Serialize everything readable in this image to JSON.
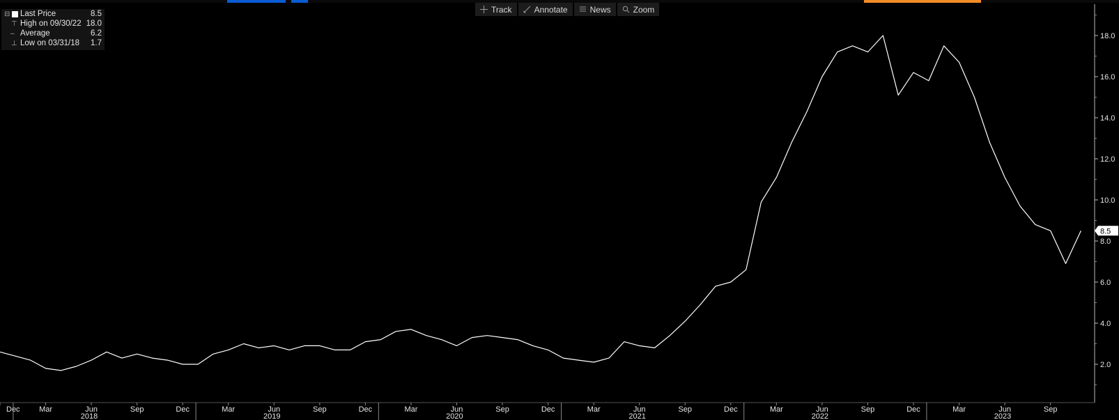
{
  "toolbar": {
    "track_label": "Track",
    "annotate_label": "Annotate",
    "news_label": "News",
    "zoom_label": "Zoom"
  },
  "legend": {
    "rows": [
      {
        "label": "Last Price",
        "value": "8.5"
      },
      {
        "label": "High on 09/30/22",
        "value": "18.0"
      },
      {
        "label": "Average",
        "value": "6.2"
      },
      {
        "label": "Low on 03/31/18",
        "value": "1.7"
      }
    ]
  },
  "colors": {
    "background": "#000000",
    "line": "#ffffff",
    "tab_blue": "#0b5bd3",
    "tab_orange": "#f28c28"
  },
  "last_price_badge": "8.5",
  "chart_data": {
    "type": "line",
    "title": "",
    "xlabel": "",
    "ylabel": "",
    "ylim": [
      0.6,
      19.2
    ],
    "yticks": [
      "2.0",
      "4.0",
      "6.0",
      "8.0",
      "10.0",
      "12.0",
      "14.0",
      "16.0",
      "18.0"
    ],
    "grid": false,
    "x_month_labels": [
      "Dec",
      "Mar",
      "Jun",
      "Sep",
      "Dec",
      "Mar",
      "Jun",
      "Sep",
      "Dec",
      "Mar",
      "Jun",
      "Sep",
      "Dec",
      "Mar",
      "Jun",
      "Sep",
      "Dec",
      "Mar",
      "Jun",
      "Sep",
      "Dec",
      "Mar",
      "Jun",
      "Sep"
    ],
    "x_year_labels": [
      "2018",
      "2019",
      "2020",
      "2021",
      "2022",
      "2023"
    ],
    "series": [
      {
        "values": [
          2.6,
          2.4,
          2.2,
          1.8,
          1.7,
          1.9,
          2.2,
          2.6,
          2.3,
          2.5,
          2.3,
          2.2,
          2.0,
          2.0,
          2.5,
          2.7,
          3.0,
          2.8,
          2.9,
          2.7,
          2.9,
          2.9,
          2.7,
          2.7,
          3.1,
          3.2,
          3.6,
          3.7,
          3.4,
          3.2,
          2.9,
          3.3,
          3.4,
          3.3,
          3.2,
          2.9,
          2.7,
          2.3,
          2.2,
          2.1,
          2.3,
          3.1,
          2.9,
          2.8,
          3.4,
          4.1,
          4.9,
          5.8,
          6.0,
          6.6,
          9.9,
          11.1,
          12.8,
          14.3,
          16.0,
          17.2,
          17.5,
          17.2,
          18.0,
          15.1,
          16.2,
          15.8,
          17.5,
          16.7,
          15.0,
          12.8,
          11.1,
          9.7,
          8.8,
          8.5,
          6.9,
          8.5
        ]
      }
    ]
  }
}
